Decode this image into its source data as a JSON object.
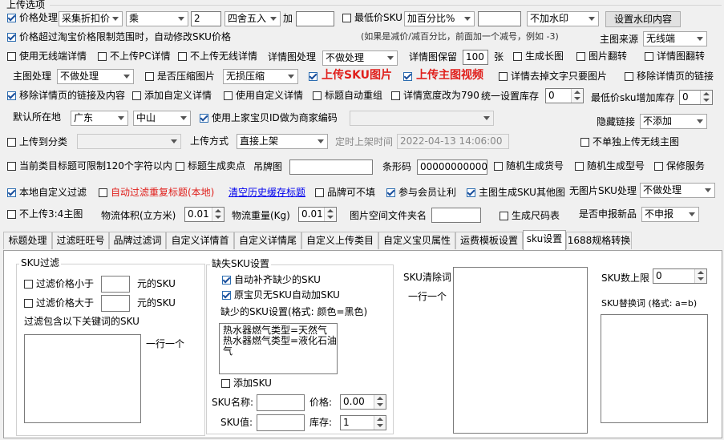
{
  "section_title": "上传选项",
  "row1": {
    "price_label": "价格处理",
    "price_source": "采集折扣价",
    "operator": "乘",
    "multiplier": "2",
    "rounding": "四舍五入",
    "add_label": "加",
    "add_value": "",
    "min_price_label": "最低价SKU",
    "percent_mode": "加百分比%",
    "percent_value": "",
    "watermark": "不加水印",
    "watermark_btn": "设置水印内容"
  },
  "row2": {
    "auto_fix_label": "价格超过淘宝价格限制范围时，自动修改SKU价格",
    "hint": "(如果是减价/减百分比，前面加一个减号，例如 -3)",
    "main_img_source_label": "主图来源",
    "main_img_source": "无线端"
  },
  "row3": {
    "wireless_detail": "使用无线端详情",
    "no_pc_detail": "不上传PC详情",
    "no_wireless_detail": "不上传无线详情",
    "detail_img_label": "详情图处理",
    "detail_img": "不做处理",
    "detail_keep_label": "详情图保留",
    "detail_keep_value": "100",
    "detail_keep_unit": "张",
    "long_img": "生成长图",
    "img_flip": "图片翻转",
    "detail_flip": "详情图翻转"
  },
  "row4": {
    "main_img_label": "主图处理",
    "main_img": "不做处理",
    "compress_label": "是否压缩图片",
    "compress": "无损压缩",
    "upload_sku_img": "上传SKU图片",
    "upload_main_video": "上传主图视频",
    "detail_remove_text": "详情去掉文字只要图片",
    "remove_detail_links": "移除详情页的链接"
  },
  "row5": {
    "remove_links_content": "移除详情页的链接及内容",
    "add_custom_detail": "添加自定义详情",
    "use_custom_detail": "使用自定义详情",
    "title_auto_group": "标题自动重组",
    "detail_width": "详情宽度改为790",
    "unify_stock_label": "统一设置库存",
    "unify_stock_value": "0",
    "min_sku_stock_label": "最低价sku增加库存",
    "min_sku_stock_value": "0"
  },
  "row6": {
    "location_label": "默认所在地",
    "province": "广东",
    "city": "中山",
    "use_id_label": "使用上家宝贝ID做为商家编码",
    "id_select": "",
    "hide_link_label": "隐藏链接",
    "hide_link": "不添加"
  },
  "row7": {
    "upload_category_label": "上传到分类",
    "category": "",
    "upload_method_label": "上传方式",
    "upload_method": "直接上架",
    "scheduled_label": "定时上架时间",
    "scheduled_value": "2022-04-13 14:06:00",
    "no_wireless_main": "不单独上传无线主图"
  },
  "row8": {
    "title_limit": "当前类目标题可限制120个字符以内",
    "title_selling": "标题生成卖点",
    "tag_img_label": "吊牌图",
    "tag_img_value": "",
    "barcode_label": "条形码",
    "barcode_value": "0000000000000",
    "random_item_no": "随机生成货号",
    "random_model": "随机生成型号",
    "warranty": "保修服务"
  },
  "row9": {
    "local_filter": "本地自定义过滤",
    "auto_filter_dup": "自动过滤重复标题(本地)",
    "clear_cache_link": "清空历史缓存标题",
    "brand_optional": "品牌可不填",
    "member_discount": "参与会员让利",
    "main_img_sku": "主图生成SKU其他图",
    "no_img_sku_label": "无图片SKU处理",
    "no_img_sku": "不做处理"
  },
  "row10": {
    "no_34_main": "不上传3:4主图",
    "volume_label": "物流体积(立方米)",
    "volume_value": "0.01",
    "weight_label": "物流重量(Kg)",
    "weight_value": "0.01",
    "folder_label": "图片空间文件夹名",
    "folder_value": "",
    "size_chart": "生成尺码表",
    "declare_new_label": "是否申报新品",
    "declare_new": "不申报"
  },
  "tabs": [
    {
      "label": "标题处理"
    },
    {
      "label": "过滤旺旺号"
    },
    {
      "label": "品牌过滤词"
    },
    {
      "label": "自定义详情首"
    },
    {
      "label": "自定义详情尾"
    },
    {
      "label": "自定义上传类目"
    },
    {
      "label": "自定义宝贝属性"
    },
    {
      "label": "运费模板设置"
    },
    {
      "label": "sku设置"
    },
    {
      "label": "1688规格转换"
    }
  ],
  "sku_panel": {
    "filter_group": "SKU过滤",
    "price_lt_label": "过滤价格小于",
    "price_lt_value": "",
    "price_lt_unit": "元的SKU",
    "price_gt_label": "过滤价格大于",
    "price_gt_value": "",
    "price_gt_unit": "元的SKU",
    "keyword_label": "过滤包含以下关键词的SKU",
    "keyword_value": "",
    "one_per_line": "一行一个",
    "missing_group": "缺失SKU设置",
    "auto_fill": "自动补齐缺少的SKU",
    "auto_add": "原宝贝无SKU自动加SKU",
    "missing_setting_label": "缺少的SKU设置(格式: 颜色=黑色)",
    "missing_setting_value": "热水器燃气类型=天然气\n热水器燃气类型=液化石油\n气",
    "add_sku": "添加SKU",
    "sku_name_label": "SKU名称:",
    "sku_name_value": "",
    "price_label": "价格:",
    "price_value": "0.00",
    "sku_value_label": "SKU值:",
    "sku_value_value": "",
    "stock_label": "库存:",
    "stock_value": "1",
    "clear_words_label": "SKU清除词",
    "clear_words_hint": "一行一个",
    "clear_words_value": "",
    "sku_limit_label": "SKU数上限",
    "sku_limit_value": "0",
    "replace_label": "SKU替换词 (格式: a=b)",
    "replace_value": ""
  }
}
